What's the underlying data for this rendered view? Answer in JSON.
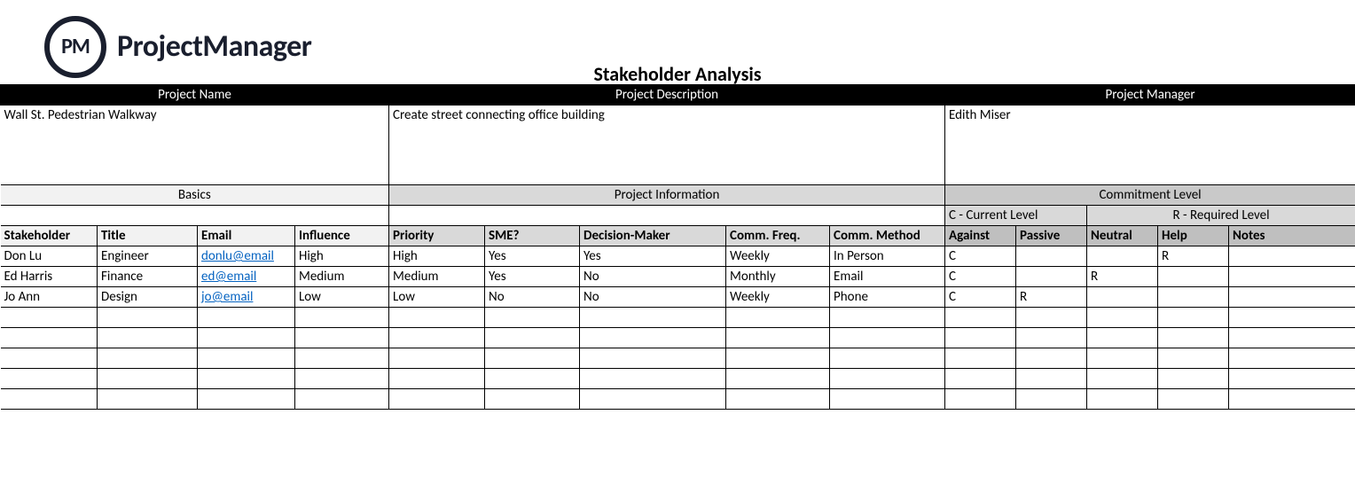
{
  "brand": {
    "logo_mark": "PM",
    "logo_text": "ProjectManager"
  },
  "title": "Stakeholder Analysis",
  "meta": {
    "headers": {
      "project_name": "Project Name",
      "project_description": "Project Description",
      "project_manager": "Project Manager"
    },
    "values": {
      "project_name": "Wall St. Pedestrian Walkway",
      "project_description": "Create street connecting office building",
      "project_manager": "Edith Miser"
    }
  },
  "sections": {
    "basics": "Basics",
    "project_info": "Project Information",
    "commitment": "Commitment Level"
  },
  "legend": {
    "current": "C - Current Level",
    "required": "R - Required Level"
  },
  "columns": {
    "stakeholder": "Stakeholder",
    "title": "Title",
    "email": "Email",
    "influence": "Influence",
    "priority": "Priority",
    "sme": "SME?",
    "decision_maker": "Decision-Maker",
    "comm_freq": "Comm. Freq.",
    "comm_method": "Comm. Method",
    "against": "Against",
    "passive": "Passive",
    "neutral": "Neutral",
    "help": "Help",
    "notes": "Notes"
  },
  "rows": [
    {
      "stakeholder": "Don Lu",
      "title": "Engineer",
      "email": "donlu@email",
      "influence": "High",
      "priority": "High",
      "sme": "Yes",
      "decision_maker": "Yes",
      "comm_freq": "Weekly",
      "comm_method": "In Person",
      "against": "C",
      "passive": "",
      "neutral": "",
      "help": "R",
      "notes": ""
    },
    {
      "stakeholder": "Ed Harris",
      "title": "Finance",
      "email": "ed@email",
      "influence": "Medium",
      "priority": "Medium",
      "sme": "Yes",
      "decision_maker": "No",
      "comm_freq": "Monthly",
      "comm_method": "Email",
      "against": "C",
      "passive": "",
      "neutral": "R",
      "help": "",
      "notes": ""
    },
    {
      "stakeholder": "Jo Ann",
      "title": "Design",
      "email": "jo@email",
      "influence": "Low",
      "priority": "Low",
      "sme": "No",
      "decision_maker": "No",
      "comm_freq": "Weekly",
      "comm_method": "Phone",
      "against": "C",
      "passive": "R",
      "neutral": "",
      "help": "",
      "notes": ""
    }
  ],
  "empty_row_count": 5
}
